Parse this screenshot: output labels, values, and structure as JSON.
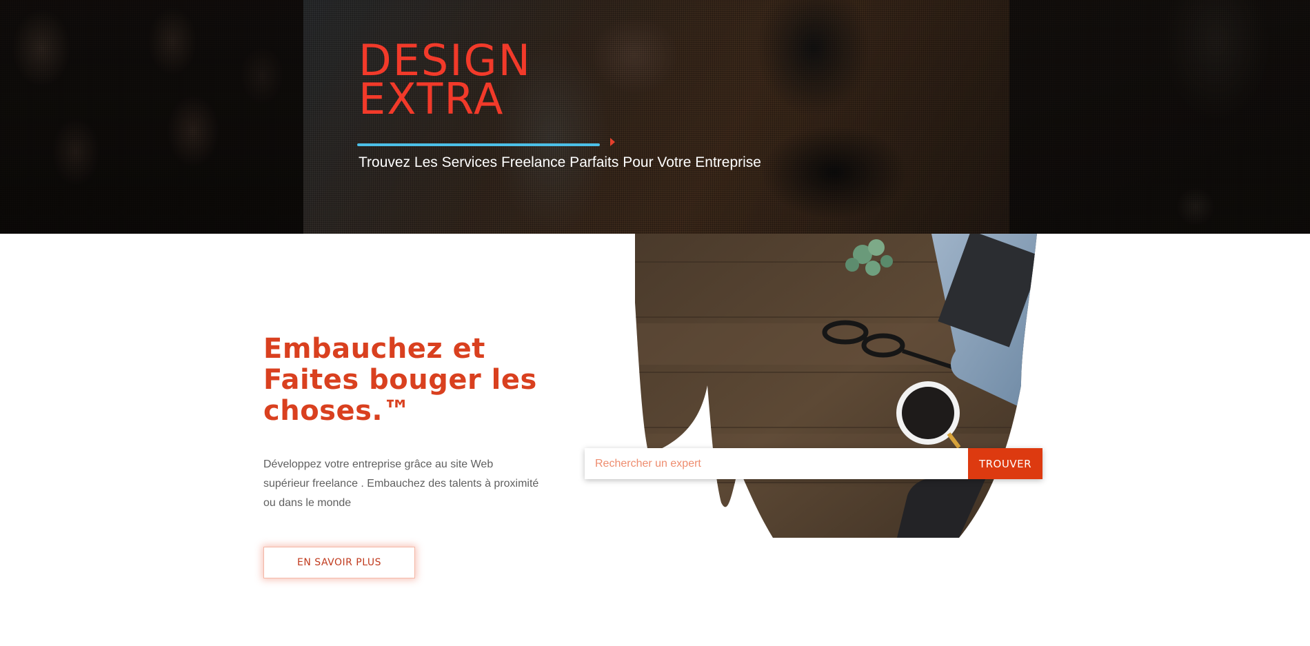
{
  "hero": {
    "title_line1": "DESIGN",
    "title_line2": "EXTRA",
    "subtitle": "Trouvez Les Services Freelance Parfaits Pour Votre Entreprise"
  },
  "content": {
    "heading": "Embauchez et Faites bouger les choses.™",
    "description": "Développez votre entreprise grâce au site Web supérieur freelance . Embauchez des talents à proximité ou dans le monde",
    "learn_more_label": "EN SAVOIR PLUS"
  },
  "search": {
    "placeholder": "Rechercher un expert",
    "value": "",
    "button_label": "TROUVER"
  },
  "colors": {
    "accent": "#dd3a10",
    "hero_title": "#f23a2a",
    "hero_line": "#4cc0e8",
    "button_border": "#f4b7a6"
  },
  "icons": {
    "hero_arrow": "triangle-right-icon"
  }
}
